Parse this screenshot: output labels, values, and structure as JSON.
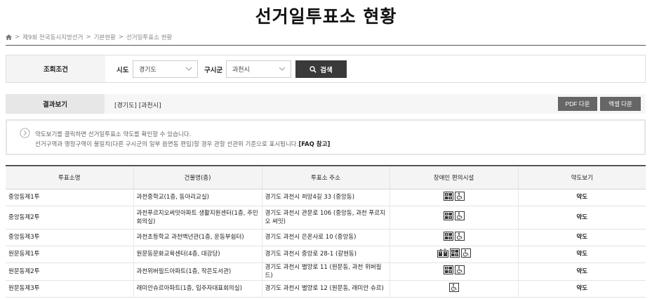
{
  "page": {
    "title": "선거일투표소 현황"
  },
  "breadcrumb": {
    "items": [
      "제9회 전국동시지방선거",
      "기본현황",
      "선거일투표소 현황"
    ],
    "separator": ">"
  },
  "search": {
    "section_label": "조회조건",
    "sido_label": "시도",
    "sido_value": "경기도",
    "sigungu_label": "구시군",
    "sigungu_value": "과천시",
    "button_label": "검색"
  },
  "result": {
    "section_label": "결과보기",
    "summary": "[경기도] [과천시]",
    "pdf_label": "PDF 다운",
    "excel_label": "엑셀 다운"
  },
  "notice": {
    "line1": "약도보기를 클릭하면 선거일투표소 약도를 확인할 수 있습니다.",
    "line2": "선거구역과 행정구역이 불일치(다른 구시군의 일부 읍면동 편입)할 경우 관할 선관위 기준으로 표시됩니다.",
    "faq": "[FAQ 참고]"
  },
  "table": {
    "headers": [
      "투표소명",
      "건물명(층)",
      "투표소 주소",
      "장애인 편의시설",
      "약도보기"
    ],
    "rows": [
      {
        "name": "중앙동제1투",
        "building": "과천중학교(1층, 동아리교실)",
        "address": "경기도 과천시 희망4길 33 (중앙동)",
        "facilities": [
          "elevator-icon",
          "wheelchair-icon"
        ],
        "map": "약도"
      },
      {
        "name": "중앙동제2투",
        "building": "과천푸르지오써밋아파트 생활지원센터(1층, 주민회의실)",
        "address": "경기도 과천시 관문로 106 (중앙동, 과천 푸르지오 써밋)",
        "facilities": [
          "elevator-icon",
          "wheelchair-icon"
        ],
        "map": "약도"
      },
      {
        "name": "중앙동제3투",
        "building": "과천초등학교 과천백년관(1층, 운동부쉼터)",
        "address": "경기도 과천시 은온사로 10 (중앙동)",
        "facilities": [
          "elevator-icon",
          "wheelchair-icon"
        ],
        "map": "약도"
      },
      {
        "name": "원문동제1투",
        "building": "원문동문화교육센터(4층, 대강당)",
        "address": "경기도 과천시 중앙로 28-1 (갈현동)",
        "facilities": [
          "lift-icon",
          "elevator-icon",
          "wheelchair-icon"
        ],
        "map": "약도"
      },
      {
        "name": "원문동제2투",
        "building": "과천위버필드아파트(1층, 작은도서관)",
        "address": "경기도 과천시 별양로 11 (원문동, 과천 위버필드)",
        "facilities": [
          "elevator-icon",
          "wheelchair-icon"
        ],
        "map": "약도"
      },
      {
        "name": "원문동제3투",
        "building": "래미안슈르아파트(1층, 입주자대표회의실)",
        "address": "경기도 과천시 별양로 12 (원문동, 래미안 슈르)",
        "facilities": [
          "wheelchair-icon"
        ],
        "map": "약도"
      }
    ]
  }
}
